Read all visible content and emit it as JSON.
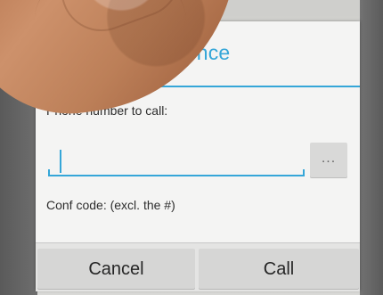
{
  "dialog": {
    "title": "int Conference",
    "phone_label": "Phone number to call:",
    "phone_value": "",
    "more_button": "...",
    "conf_label": "Conf code: (excl. the #)",
    "conf_value": ""
  },
  "buttons": {
    "cancel": "Cancel",
    "call": "Call"
  },
  "colors": {
    "accent": "#35a6d8",
    "dialog_bg": "#f4f4f3",
    "button_bg": "#d6d6d5",
    "text": "#262626"
  }
}
